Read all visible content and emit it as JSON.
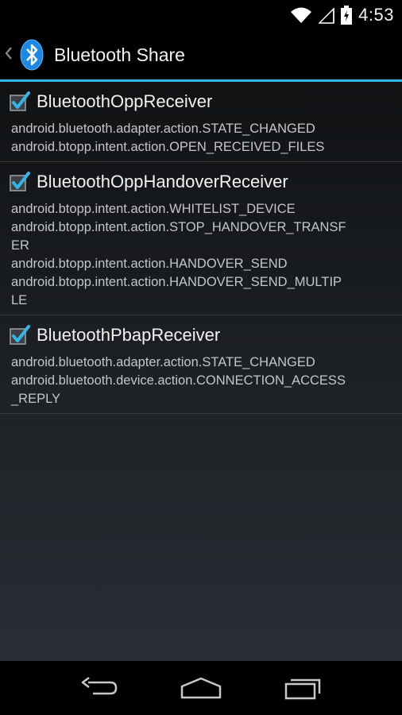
{
  "status_bar": {
    "time": "4:53"
  },
  "action_bar": {
    "title": "Bluetooth Share"
  },
  "receivers": [
    {
      "name": "BluetoothOppReceiver",
      "checked": true,
      "actions": [
        "android.bluetooth.adapter.action.STATE_CHANGED",
        "android.btopp.intent.action.OPEN_RECEIVED_FILES"
      ]
    },
    {
      "name": "BluetoothOppHandoverReceiver",
      "checked": true,
      "actions": [
        "android.btopp.intent.action.WHITELIST_DEVICE",
        "android.btopp.intent.action.STOP_HANDOVER_TRANSF",
        "ER",
        "android.btopp.intent.action.HANDOVER_SEND",
        "android.btopp.intent.action.HANDOVER_SEND_MULTIP",
        "LE"
      ]
    },
    {
      "name": "BluetoothPbapReceiver",
      "checked": true,
      "actions": [
        "android.bluetooth.adapter.action.STATE_CHANGED",
        "android.bluetooth.device.action.CONNECTION_ACCESS",
        "_REPLY"
      ]
    }
  ],
  "colors": {
    "accent": "#33b5e5",
    "bluetooth_icon": "#1e88e5"
  },
  "icons": {
    "status": [
      "wifi-icon",
      "signal-icon",
      "battery-icon"
    ],
    "nav": [
      "back-icon",
      "home-icon",
      "recents-icon"
    ]
  }
}
